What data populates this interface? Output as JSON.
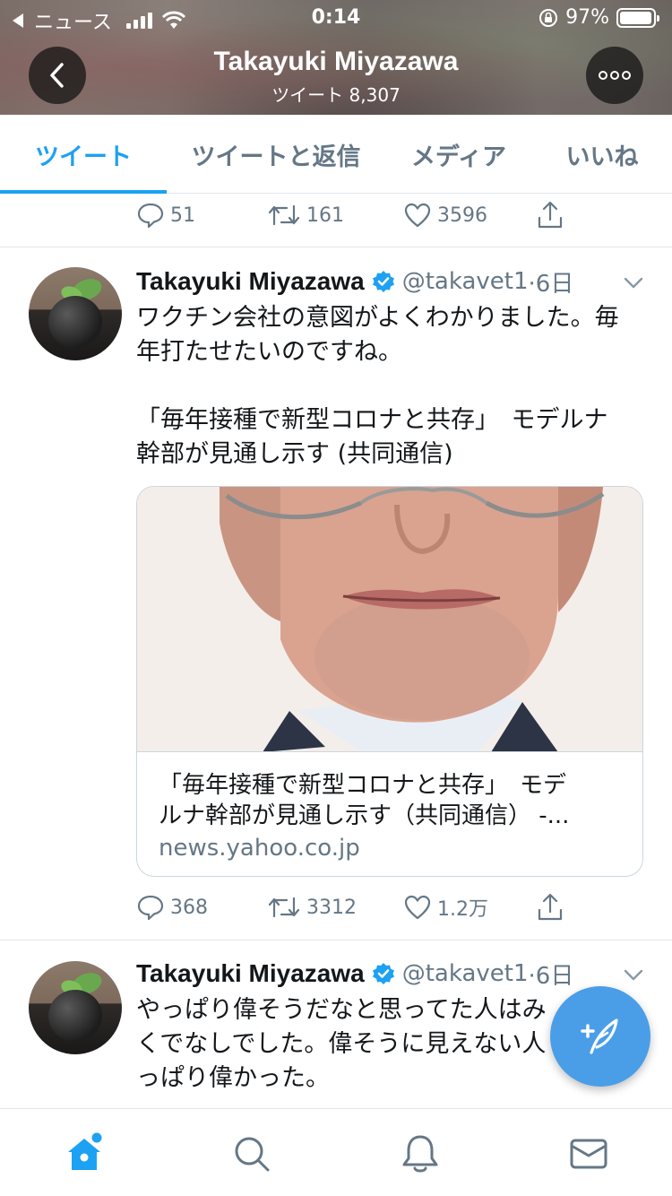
{
  "status_bar": {
    "back_app": "ニュース",
    "time": "0:14",
    "battery": "97%",
    "battery_level": 0.97
  },
  "header": {
    "title": "Takayuki Miyazawa",
    "subtitle": "ツイート 8,307"
  },
  "tabs": [
    {
      "label": "ツイート",
      "active": true
    },
    {
      "label": "ツイートと返信",
      "active": false
    },
    {
      "label": "メディア",
      "active": false
    },
    {
      "label": "いいね",
      "active": false
    }
  ],
  "top_actions": {
    "replies": "51",
    "retweets": "161",
    "likes": "3596"
  },
  "tweets": [
    {
      "name": "Takayuki Miyazawa",
      "handle": "@takavet1",
      "time": "·6日",
      "text_1": "ワクチン会社の意図がよくわかりました。毎\n年打たせたいのですね。",
      "text_2": "「毎年接種で新型コロナと共存」　モデルナ\n幹部が見通し示す (共同通信)",
      "card": {
        "title": "「毎年接種で新型コロナと共存」　モデ\nルナ幹部が見通し示す（共同通信） -...",
        "domain": "news.yahoo.co.jp"
      },
      "actions": {
        "replies": "368",
        "retweets": "3312",
        "likes": "1.2万"
      }
    },
    {
      "name": "Takayuki Miyazawa",
      "handle": "@takavet1",
      "time": "·6日",
      "text": "やっぱり偉そうだなと思ってた人はみ\nくでなしでした。偉そうに見えない人\nっぱり偉かった。"
    }
  ],
  "colors": {
    "accent": "#1da1f2",
    "secondary_text": "#657786",
    "verified": "#1da1f2",
    "fab": "#4a9ee8"
  },
  "icons": {
    "back": "chevron-left-icon",
    "more": "ellipsis-icon",
    "reply": "speech-bubble-icon",
    "retweet": "retweet-icon",
    "like": "heart-icon",
    "share": "share-icon",
    "verified": "verified-badge-icon",
    "caret": "chevron-down-icon",
    "compose": "compose-tweet-icon",
    "home": "home-icon",
    "search": "search-icon",
    "notifications": "bell-icon",
    "messages": "envelope-icon"
  }
}
